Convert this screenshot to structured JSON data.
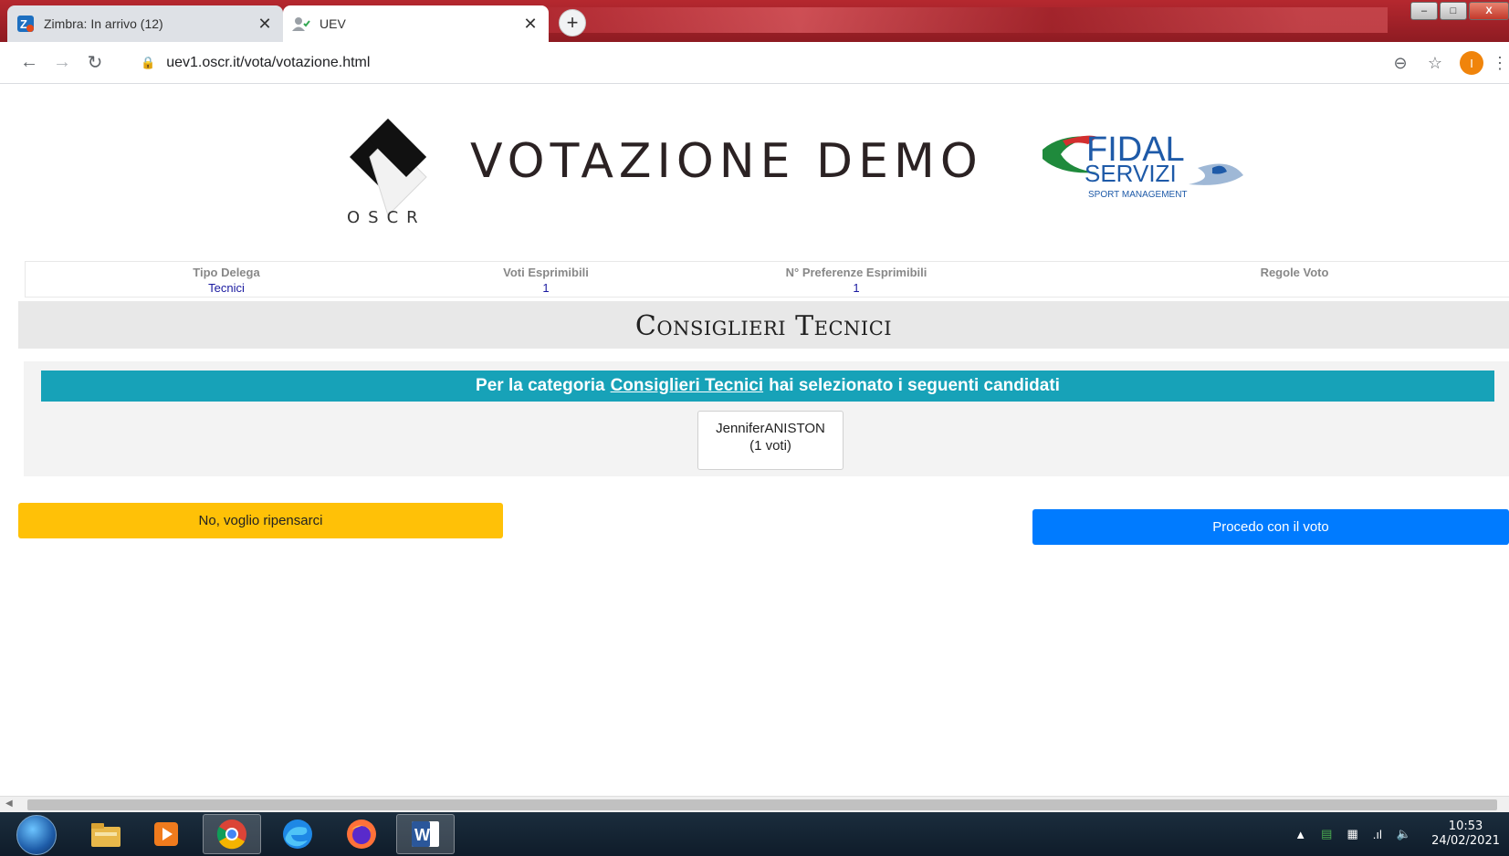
{
  "browser": {
    "tabs": [
      {
        "title": "Zimbra: In arrivo (12)",
        "icon": "zimbra-icon"
      },
      {
        "title": "UEV",
        "icon": "user-check-icon"
      }
    ],
    "url": "uev1.oscr.it/vota/votazione.html",
    "profile_initial": "I"
  },
  "header": {
    "logo_text": "OSCR",
    "title": "VOTAZIONE DEMO",
    "partner_logo": {
      "line1": "FIDAL",
      "line2": "SERVIZI",
      "line3": "SPORT MANAGEMENT"
    }
  },
  "info": {
    "tipo_delega_label": "Tipo Delega",
    "tipo_delega_value": "Tecnici",
    "voti_label": "Voti Esprimibili",
    "voti_value": "1",
    "preferenze_label": "N° Preferenze Esprimibili",
    "preferenze_value": "1",
    "regole_label": "Regole Voto"
  },
  "section": {
    "title": "Consiglieri Tecnici"
  },
  "summary": {
    "prefix": "Per la categoria",
    "category": "Consiglieri Tecnici",
    "suffix": "hai selezionato i seguenti candidati",
    "candidates": [
      {
        "name": "JenniferANISTON",
        "votes": "(1 voti)"
      }
    ]
  },
  "actions": {
    "rethink_label": "No, voglio ripensarci",
    "proceed_label": "Procedo con il voto"
  },
  "taskbar": {
    "time": "10:53",
    "date": "24/02/2021"
  },
  "colors": {
    "teal": "#17a2b8",
    "warning": "#ffc107",
    "primary": "#007bff"
  }
}
